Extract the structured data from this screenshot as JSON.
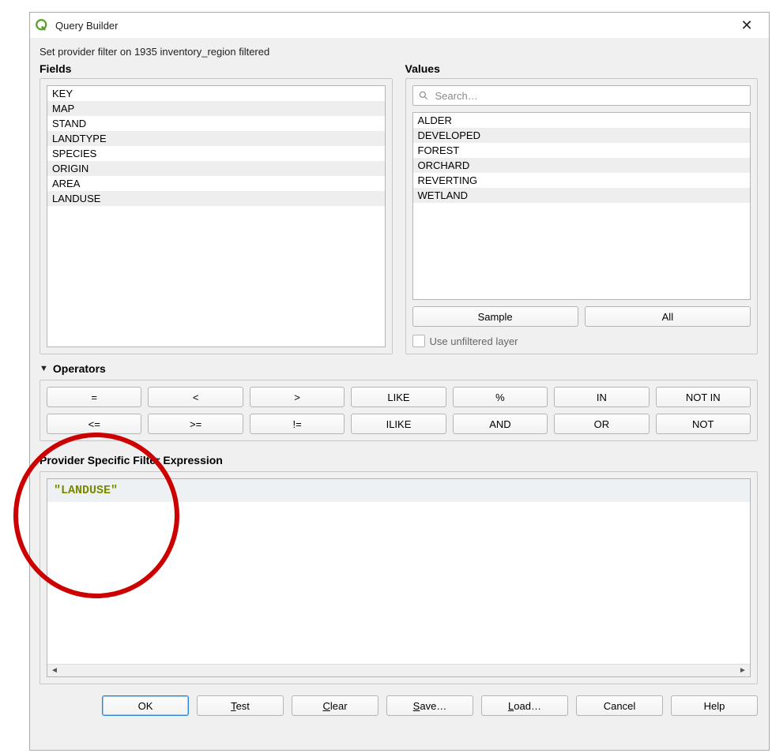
{
  "titlebar": {
    "title": "Query Builder"
  },
  "description": "Set provider filter on 1935 inventory_region filtered",
  "fields": {
    "label": "Fields",
    "items": [
      "KEY",
      "MAP",
      "STAND",
      "LANDTYPE",
      "SPECIES",
      "ORIGIN",
      "AREA",
      "LANDUSE"
    ]
  },
  "values": {
    "label": "Values",
    "search_placeholder": "Search…",
    "items": [
      "ALDER",
      "DEVELOPED",
      "FOREST",
      "ORCHARD",
      "REVERTING",
      "WETLAND"
    ],
    "sample_label": "Sample",
    "all_label": "All",
    "unfiltered_label": "Use unfiltered layer"
  },
  "operators": {
    "label": "Operators",
    "row1": [
      "=",
      "<",
      ">",
      "LIKE",
      "%",
      "IN",
      "NOT IN"
    ],
    "row2": [
      "<=",
      ">=",
      "!=",
      "ILIKE",
      "AND",
      "OR",
      "NOT"
    ]
  },
  "expression": {
    "label": "Provider Specific Filter Expression",
    "value": "\"LANDUSE\""
  },
  "buttons": {
    "ok": "OK",
    "test": "Test",
    "clear": "Clear",
    "save": "Save…",
    "load": "Load…",
    "cancel": "Cancel",
    "help": "Help"
  }
}
